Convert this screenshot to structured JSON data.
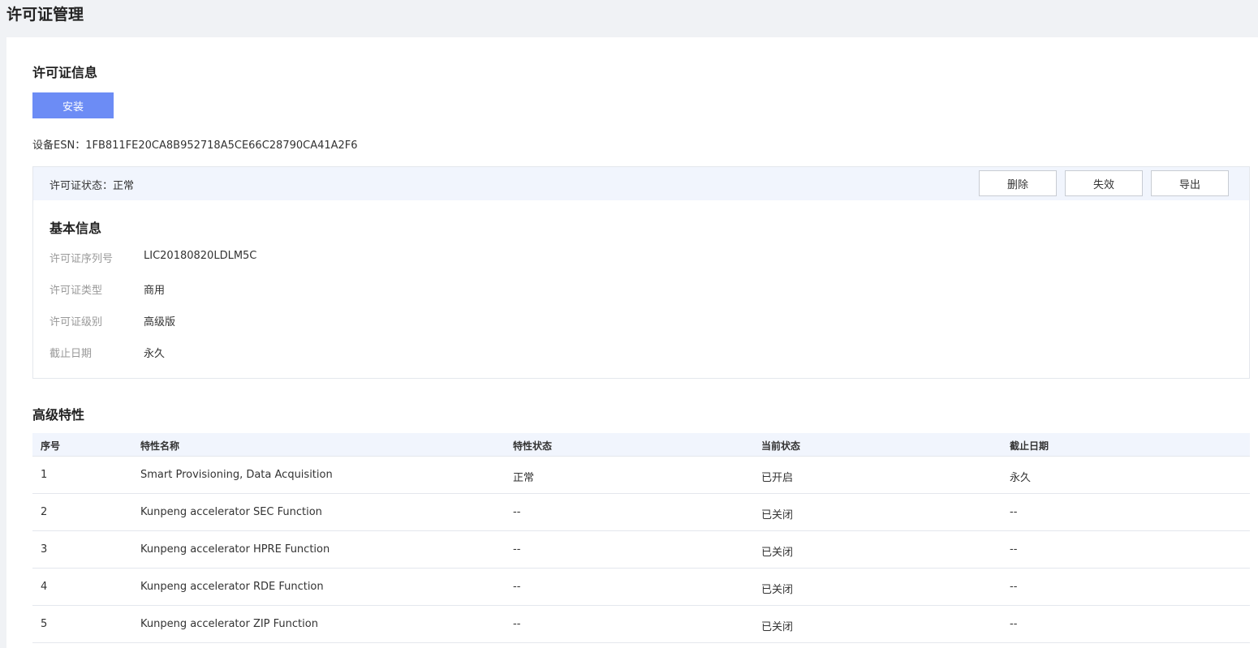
{
  "page_title": "许可证管理",
  "license_info": {
    "title": "许可证信息",
    "install_label": "安装",
    "esn_label": "设备ESN：",
    "esn_value": "1FB811FE20CA8B952718A5CE66C28790CA41A2F6",
    "status_label": "许可证状态：",
    "status_value": "正常",
    "buttons": {
      "delete": "删除",
      "invalidate": "失效",
      "export": "导出"
    },
    "basic": {
      "title": "基本信息",
      "rows": [
        {
          "label": "许可证序列号",
          "value": "LIC20180820LDLM5C"
        },
        {
          "label": "许可证类型",
          "value": "商用"
        },
        {
          "label": "许可证级别",
          "value": "高级版"
        },
        {
          "label": "截止日期",
          "value": "永久"
        }
      ]
    }
  },
  "features": {
    "title": "高级特性",
    "columns": [
      "序号",
      "特性名称",
      "特性状态",
      "当前状态",
      "截止日期"
    ],
    "rows": [
      [
        "1",
        "Smart Provisioning, Data Acquisition",
        "正常",
        "已开启",
        "永久"
      ],
      [
        "2",
        "Kunpeng accelerator SEC Function",
        "--",
        "已关闭",
        "--"
      ],
      [
        "3",
        "Kunpeng accelerator HPRE Function",
        "--",
        "已关闭",
        "--"
      ],
      [
        "4",
        "Kunpeng accelerator RDE Function",
        "--",
        "已关闭",
        "--"
      ],
      [
        "5",
        "Kunpeng accelerator ZIP Function",
        "--",
        "已关闭",
        "--"
      ]
    ]
  }
}
